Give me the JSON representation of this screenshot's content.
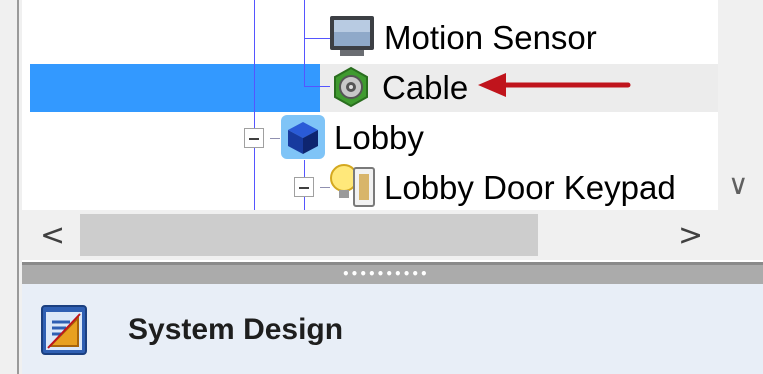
{
  "tree": {
    "nodes": [
      {
        "label": "Motion Sensor",
        "icon": "monitor-icon"
      },
      {
        "label": "Cable",
        "icon": "cable-icon",
        "selected": true
      },
      {
        "label": "Lobby",
        "icon": "cube-icon",
        "expanded": true
      },
      {
        "label": "Lobby Door Keypad",
        "icon": "keypad-bulb-icon",
        "expanded": true
      }
    ]
  },
  "scrollbars": {
    "left_arrow": "<",
    "right_arrow": ">",
    "down_arrow": "∨"
  },
  "splitter": {
    "grip": "••••••••••"
  },
  "bottom_panel": {
    "label": "System Design",
    "icon": "system-design-icon"
  },
  "annotation": {
    "color": "#c0141c",
    "icon": "red-arrow-icon"
  },
  "colors": {
    "selection": "#3399ff",
    "hover_row": "#ececec",
    "tree_lines": "#5555ff"
  }
}
